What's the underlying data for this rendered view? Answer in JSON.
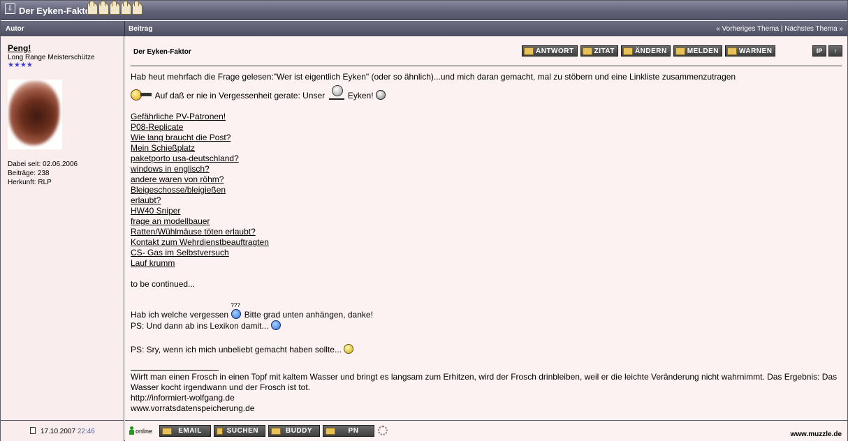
{
  "thread": {
    "title": "Der Eyken-Faktor",
    "rating_icons": [
      "thumb-up-icon",
      "thumb-up-icon",
      "thumb-up-icon",
      "thumb-up-icon",
      "thumb-up-icon"
    ]
  },
  "header": {
    "author_col": "Autor",
    "post_col": "Beitrag",
    "nav_prev": "« Vorheriges Thema",
    "nav_sep": " | ",
    "nav_next": "Nächstes Thema »"
  },
  "author": {
    "name": "Peng!",
    "rank": "Long Range Meisterschütze",
    "stars": "★★★★",
    "joined": "Dabei seit: 02.06.2006",
    "posts": "Beiträge: 238",
    "origin": "Herkunft: RLP"
  },
  "post": {
    "title": "Der Eyken-Faktor",
    "buttons": [
      "ANTWORT",
      "ZITAT",
      "ÄNDERN",
      "MELDEN",
      "WARNEN"
    ],
    "small_buttons": [
      "IP",
      "↑"
    ],
    "intro": "Hab heut mehrfach die Frage gelesen:\"Wer ist eigentlich Eyken\" (oder so ähnlich)...und mich daran gemacht, mal zu stöbern und eine Linkliste zusammenzutragen",
    "line2_a": "Auf daß er nie in Vergessenheit gerate: Unser",
    "line2_b": "Eyken!",
    "links": [
      "Gefährliche PV-Patronen!",
      "P08-Replicate",
      "Wie lang braucht die Post?",
      "Mein Schießplatz",
      "paketporto usa-deutschland?",
      "windows in englisch?",
      "andere waren von röhm?",
      "Bleigeschosse/bleigießen",
      "erlaubt?",
      "HW40 Sniper",
      "frage an modellbauer",
      "Ratten/Wühlmäuse töten erlaubt?",
      "Kontakt zum Wehrdienstbeauftragten",
      "CS- Gas im Selbstversuch",
      "Lauf krumm"
    ],
    "continued": "to be continued...",
    "forgot_a": "Hab ich welche vergessen",
    "forgot_q": "???",
    "forgot_b": "Bitte grad unten anhängen, danke!",
    "ps1": "PS: Und dann ab ins Lexikon damit...",
    "ps2": "PS: Sry, wenn ich mich unbeliebt gemacht haben sollte...",
    "signature": [
      "Wirft man einen Frosch in einen Topf mit kaltem Wasser und bringt es langsam zum Erhitzen, wird der Frosch drinbleiben, weil er die leichte Veränderung nicht wahrnimmt. Das Ergebnis: Das Wasser kocht irgendwann und der Frosch ist tot.",
      "http://informiert-wolfgang.de",
      "www.vorratsdatenspeicherung.de"
    ]
  },
  "footer": {
    "date": "17.10.2007",
    "time": "22:46",
    "online": "online",
    "buttons": [
      "EMAIL",
      "SUCHEN",
      "BUDDY",
      "PN"
    ],
    "site": "www.muzzle.de"
  }
}
